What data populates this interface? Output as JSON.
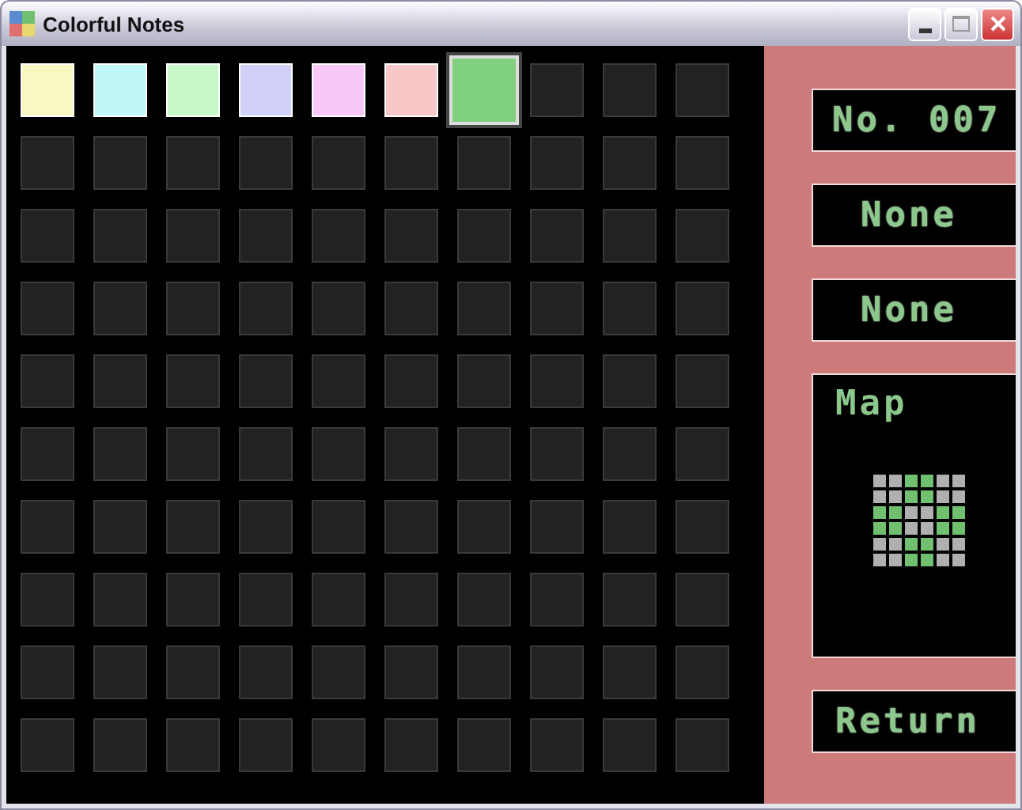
{
  "window": {
    "title": "Colorful Notes"
  },
  "grid": [
    {
      "cells": [
        {
          "color": "#f8f8c0",
          "selected": false
        },
        {
          "color": "#c0f8f8",
          "selected": false
        },
        {
          "color": "#c8f8c8",
          "selected": false
        },
        {
          "color": "#d0d0f8",
          "selected": false
        },
        {
          "color": "#f8c8f8",
          "selected": false
        },
        {
          "color": "#f8c8c8",
          "selected": false
        },
        {
          "color": "#80d080",
          "selected": true
        },
        {
          "selected": false
        },
        {
          "selected": false
        },
        {
          "selected": false
        }
      ]
    },
    {
      "cells": [
        {
          "selected": false
        },
        {
          "selected": false
        },
        {
          "selected": false
        },
        {
          "selected": false
        },
        {
          "selected": false
        },
        {
          "selected": false
        },
        {
          "selected": false
        },
        {
          "selected": false
        },
        {
          "selected": false
        },
        {
          "selected": false
        }
      ]
    },
    {
      "cells": [
        {
          "selected": false
        },
        {
          "selected": false
        },
        {
          "selected": false
        },
        {
          "selected": false
        },
        {
          "selected": false
        },
        {
          "selected": false
        },
        {
          "selected": false
        },
        {
          "selected": false
        },
        {
          "selected": false
        },
        {
          "selected": false
        }
      ]
    },
    {
      "cells": [
        {
          "selected": false
        },
        {
          "selected": false
        },
        {
          "selected": false
        },
        {
          "selected": false
        },
        {
          "selected": false
        },
        {
          "selected": false
        },
        {
          "selected": false
        },
        {
          "selected": false
        },
        {
          "selected": false
        },
        {
          "selected": false
        }
      ]
    },
    {
      "cells": [
        {
          "selected": false
        },
        {
          "selected": false
        },
        {
          "selected": false
        },
        {
          "selected": false
        },
        {
          "selected": false
        },
        {
          "selected": false
        },
        {
          "selected": false
        },
        {
          "selected": false
        },
        {
          "selected": false
        },
        {
          "selected": false
        }
      ]
    },
    {
      "cells": [
        {
          "selected": false
        },
        {
          "selected": false
        },
        {
          "selected": false
        },
        {
          "selected": false
        },
        {
          "selected": false
        },
        {
          "selected": false
        },
        {
          "selected": false
        },
        {
          "selected": false
        },
        {
          "selected": false
        },
        {
          "selected": false
        }
      ]
    },
    {
      "cells": [
        {
          "selected": false
        },
        {
          "selected": false
        },
        {
          "selected": false
        },
        {
          "selected": false
        },
        {
          "selected": false
        },
        {
          "selected": false
        },
        {
          "selected": false
        },
        {
          "selected": false
        },
        {
          "selected": false
        },
        {
          "selected": false
        }
      ]
    },
    {
      "cells": [
        {
          "selected": false
        },
        {
          "selected": false
        },
        {
          "selected": false
        },
        {
          "selected": false
        },
        {
          "selected": false
        },
        {
          "selected": false
        },
        {
          "selected": false
        },
        {
          "selected": false
        },
        {
          "selected": false
        },
        {
          "selected": false
        }
      ]
    },
    {
      "cells": [
        {
          "selected": false
        },
        {
          "selected": false
        },
        {
          "selected": false
        },
        {
          "selected": false
        },
        {
          "selected": false
        },
        {
          "selected": false
        },
        {
          "selected": false
        },
        {
          "selected": false
        },
        {
          "selected": false
        },
        {
          "selected": false
        }
      ]
    },
    {
      "cells": [
        {
          "selected": false
        },
        {
          "selected": false
        },
        {
          "selected": false
        },
        {
          "selected": false
        },
        {
          "selected": false
        },
        {
          "selected": false
        },
        {
          "selected": false
        },
        {
          "selected": false
        },
        {
          "selected": false
        },
        {
          "selected": false
        }
      ]
    }
  ],
  "sidebar": {
    "number": "No. 007",
    "field_1": "None",
    "field_2": "None",
    "map": {
      "title": "Map",
      "rows": [
        {
          "cells": [
            {
              "on": false
            },
            {
              "on": false
            },
            {
              "on": true
            },
            {
              "on": true
            },
            {
              "on": false
            },
            {
              "on": false
            }
          ]
        },
        {
          "cells": [
            {
              "on": false
            },
            {
              "on": false
            },
            {
              "on": true
            },
            {
              "on": true
            },
            {
              "on": false
            },
            {
              "on": false
            }
          ]
        },
        {
          "cells": [
            {
              "on": true
            },
            {
              "on": true
            },
            {
              "on": false
            },
            {
              "on": false
            },
            {
              "on": true
            },
            {
              "on": true
            }
          ]
        },
        {
          "cells": [
            {
              "on": true
            },
            {
              "on": true
            },
            {
              "on": false
            },
            {
              "on": false
            },
            {
              "on": true
            },
            {
              "on": true
            }
          ]
        },
        {
          "cells": [
            {
              "on": false
            },
            {
              "on": false
            },
            {
              "on": true
            },
            {
              "on": true
            },
            {
              "on": false
            },
            {
              "on": false
            }
          ]
        },
        {
          "cells": [
            {
              "on": false
            },
            {
              "on": false
            },
            {
              "on": true
            },
            {
              "on": true
            },
            {
              "on": false
            },
            {
              "on": false
            }
          ]
        }
      ]
    },
    "return_label": "Return"
  }
}
